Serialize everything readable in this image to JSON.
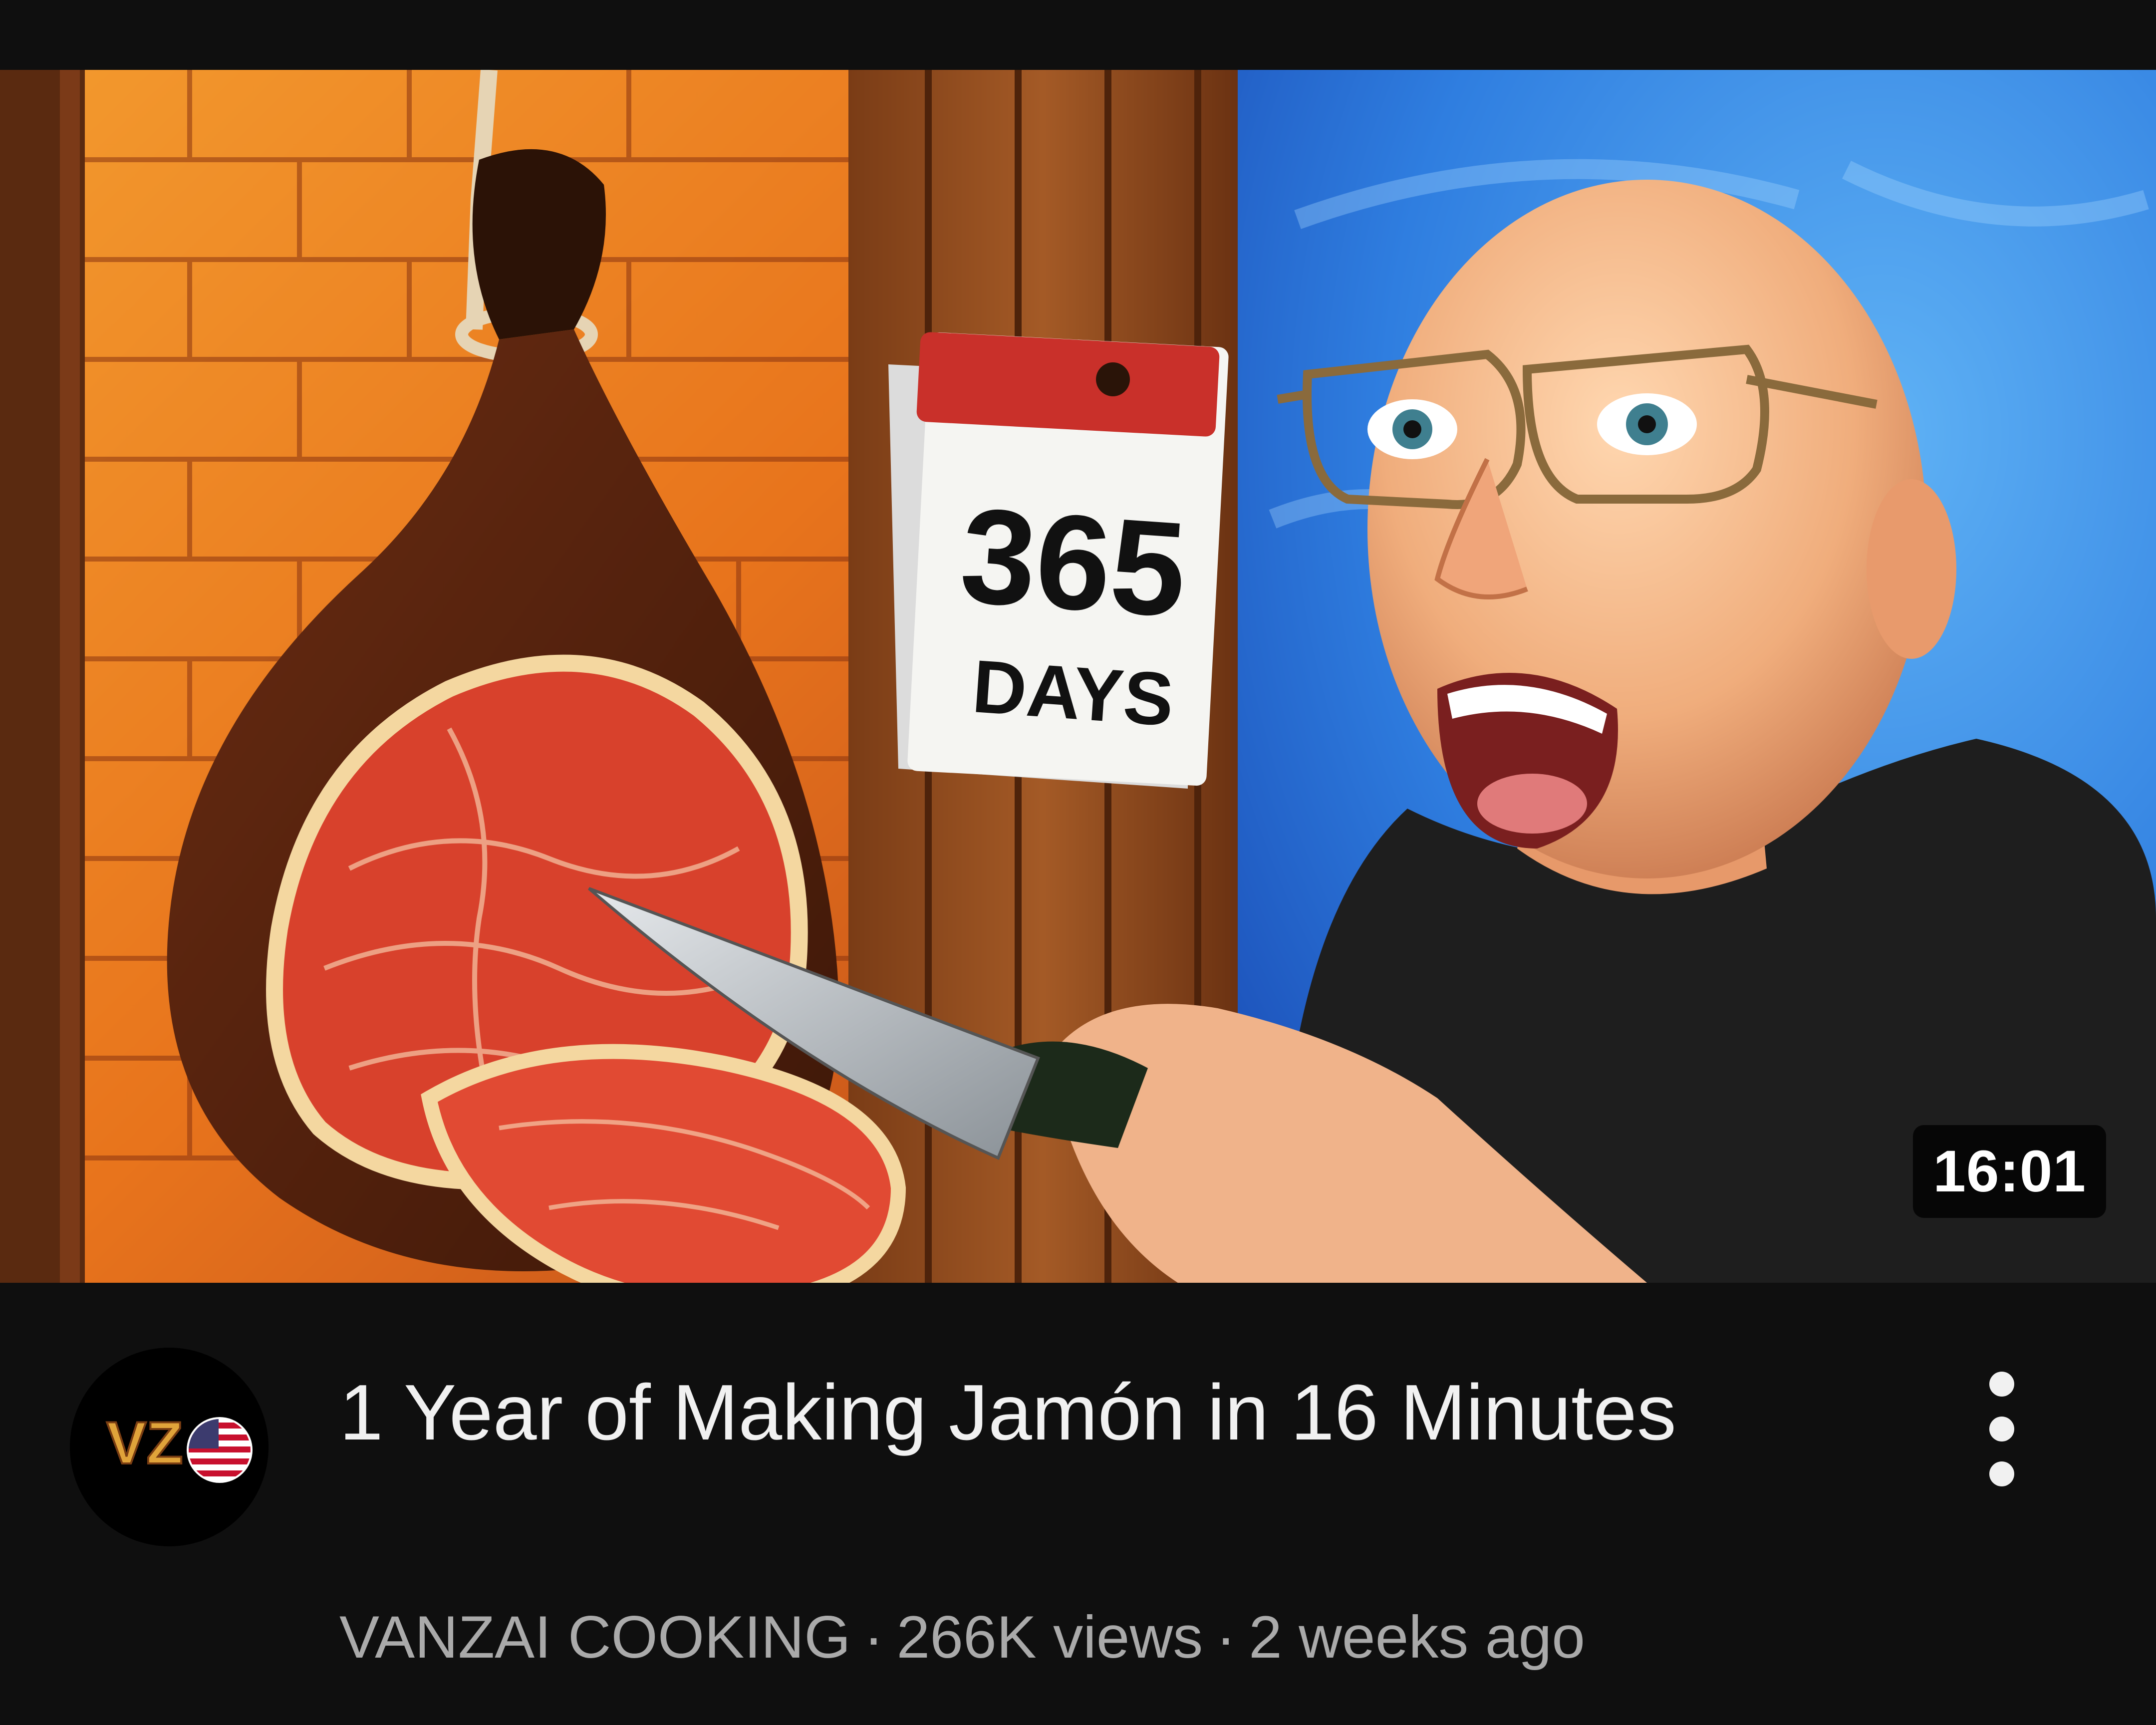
{
  "video": {
    "duration": "16:01",
    "title": "1 Year of Making Jamón in 16 Minutes",
    "channel": "VANZAI COOKING",
    "views": "266K views",
    "age": "2 weeks ago",
    "separator": "·"
  },
  "thumbnail": {
    "calendar_number": "365",
    "calendar_label": "DAYS"
  },
  "avatar": {
    "logo_text": "VZ"
  },
  "colors": {
    "background": "#0f0f0f",
    "title_text": "#f1f1f1",
    "meta_text": "#aaaaaa",
    "badge_bg": "#000000"
  },
  "icons": {
    "more": "more-vertical-icon",
    "flag": "us-flag-icon"
  }
}
